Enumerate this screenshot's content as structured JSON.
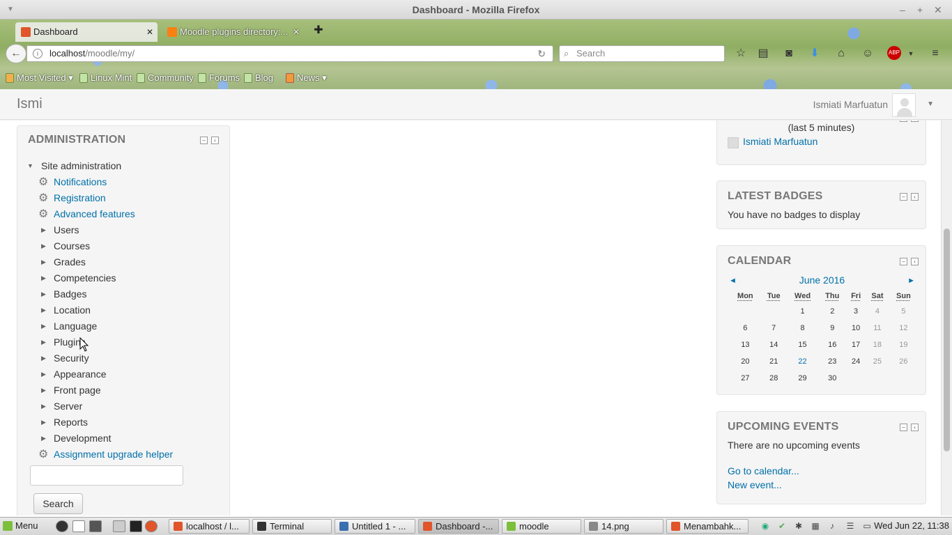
{
  "window": {
    "title": "Dashboard - Mozilla Firefox"
  },
  "tabs": [
    {
      "label": "Dashboard",
      "active": true
    },
    {
      "label": "Moodle plugins directory:...",
      "active": false
    }
  ],
  "navbar": {
    "url_host": "localhost",
    "url_path": "/moodle/my/",
    "search_placeholder": "Search"
  },
  "bookmarks": [
    "Most Visited",
    "Linux Mint",
    "Community",
    "Forums",
    "Blog",
    "News"
  ],
  "moodle": {
    "brand": "Ismi",
    "user_name": "Ismiati Marfuatun"
  },
  "admin": {
    "title": "ADMINISTRATION",
    "root": "Site administration",
    "links_top": [
      "Notifications",
      "Registration",
      "Advanced features"
    ],
    "folders": [
      "Users",
      "Courses",
      "Grades",
      "Competencies",
      "Badges",
      "Location",
      "Language",
      "Plugins",
      "Security",
      "Appearance",
      "Front page",
      "Server",
      "Reports",
      "Development"
    ],
    "link_bottom": "Assignment upgrade helper",
    "search_button": "Search"
  },
  "online_users": {
    "period": "(last 5 minutes)",
    "user": "Ismiati Marfuatun"
  },
  "badges": {
    "title": "LATEST BADGES",
    "message": "You have no badges to display"
  },
  "calendar": {
    "title": "CALENDAR",
    "month": "June 2016",
    "prev": "◄",
    "next": "►",
    "weekdays": [
      "Mon",
      "Tue",
      "Wed",
      "Thu",
      "Fri",
      "Sat",
      "Sun"
    ],
    "weeks": [
      [
        "",
        "",
        "1",
        "2",
        "3",
        "4",
        "5"
      ],
      [
        "6",
        "7",
        "8",
        "9",
        "10",
        "11",
        "12"
      ],
      [
        "13",
        "14",
        "15",
        "16",
        "17",
        "18",
        "19"
      ],
      [
        "20",
        "21",
        "22",
        "23",
        "24",
        "25",
        "26"
      ],
      [
        "27",
        "28",
        "29",
        "30",
        "",
        "",
        ""
      ]
    ],
    "today": "22"
  },
  "events": {
    "title": "UPCOMING EVENTS",
    "message": "There are no upcoming events",
    "goto": "Go to calendar...",
    "new_event": "New event..."
  },
  "taskbar": {
    "menu": "Menu",
    "tasks": [
      {
        "label": "localhost / l...",
        "icon_color": "#e0552a"
      },
      {
        "label": "Terminal",
        "icon_color": "#333333"
      },
      {
        "label": "Untitled 1 - ...",
        "icon_color": "#3a6fb0"
      },
      {
        "label": "Dashboard -...",
        "icon_color": "#e0552a",
        "active": true
      },
      {
        "label": "moodle",
        "icon_color": "#7bbf3d"
      },
      {
        "label": "14.png",
        "icon_color": "#888888"
      },
      {
        "label": "Menambahk...",
        "icon_color": "#e0552a"
      }
    ],
    "clock": "Wed Jun 22, 11:38"
  },
  "colors": {
    "link": "#0070a8",
    "mint_green": "#7bbf3d"
  }
}
